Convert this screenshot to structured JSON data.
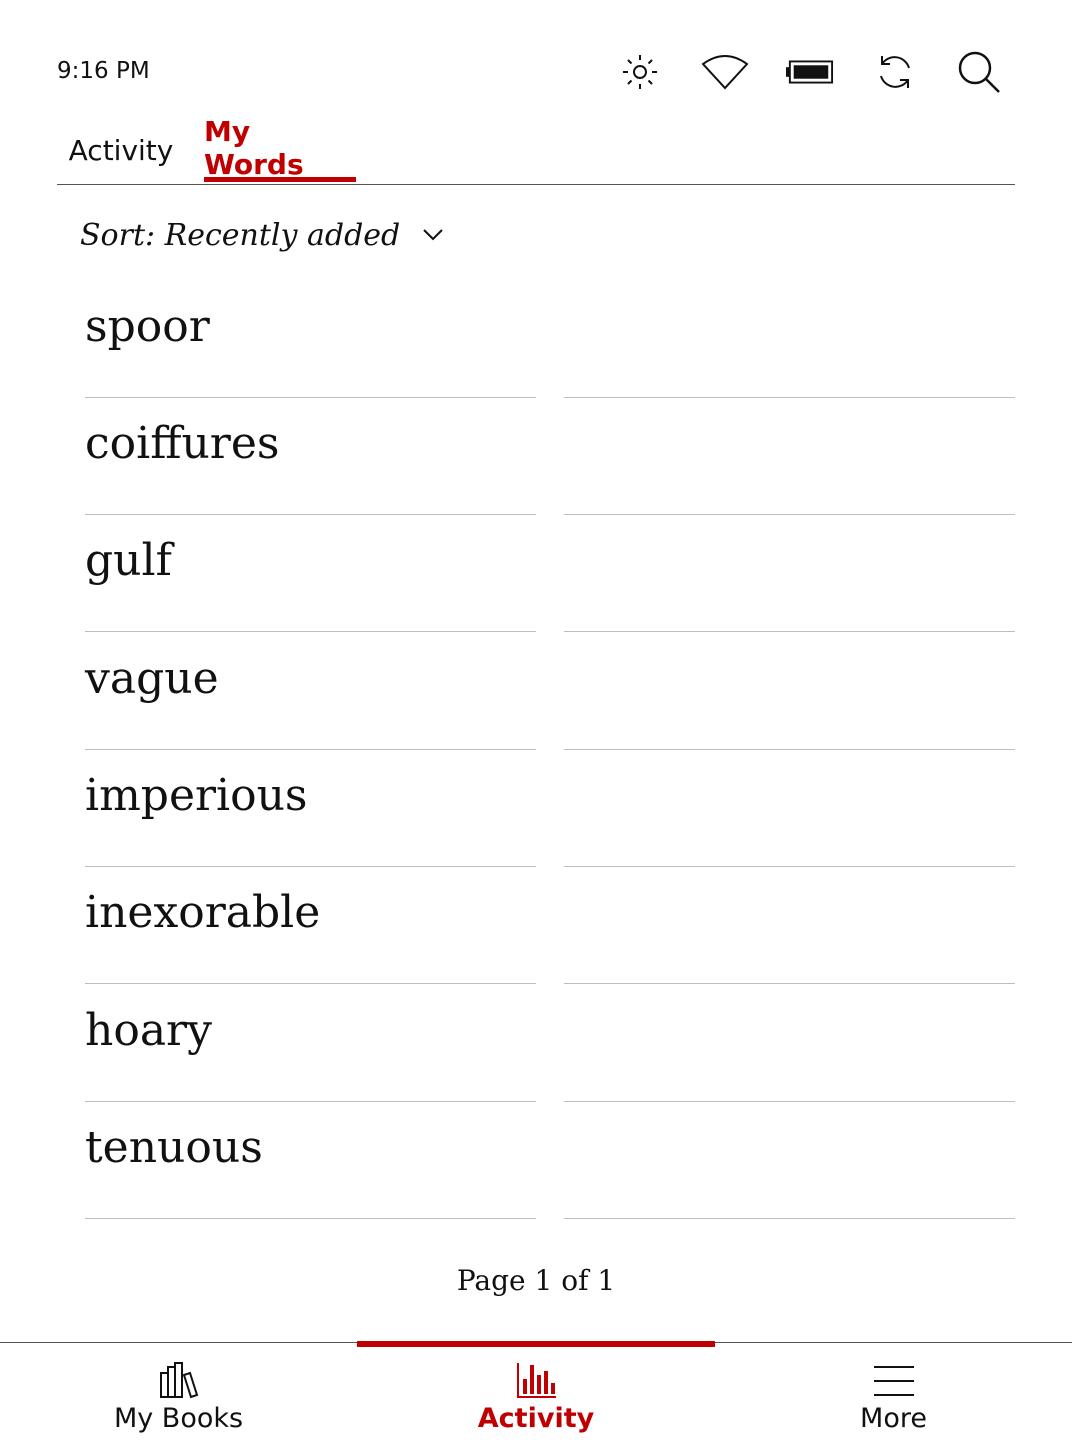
{
  "status_bar": {
    "time": "9:16 PM",
    "icons": [
      "brightness-icon",
      "wifi-icon",
      "battery-icon",
      "sync-icon",
      "search-icon"
    ]
  },
  "tabs": [
    {
      "label": "Activity",
      "active": false
    },
    {
      "label": "My Words",
      "active": true
    }
  ],
  "sort": {
    "label": "Sort: Recently added"
  },
  "words": [
    "spoor",
    "coiffures",
    "gulf",
    "vague",
    "imperious",
    "inexorable",
    "hoary",
    "tenuous"
  ],
  "pager": {
    "text": "Page 1 of 1"
  },
  "bottom_nav": [
    {
      "label": "My Books",
      "icon": "books-icon",
      "active": false
    },
    {
      "label": "Activity",
      "icon": "activity-chart-icon",
      "active": true
    },
    {
      "label": "More",
      "icon": "menu-icon",
      "active": false
    }
  ],
  "colors": {
    "accent": "#c00000",
    "text": "#111111",
    "divider": "#bdbdbd"
  }
}
